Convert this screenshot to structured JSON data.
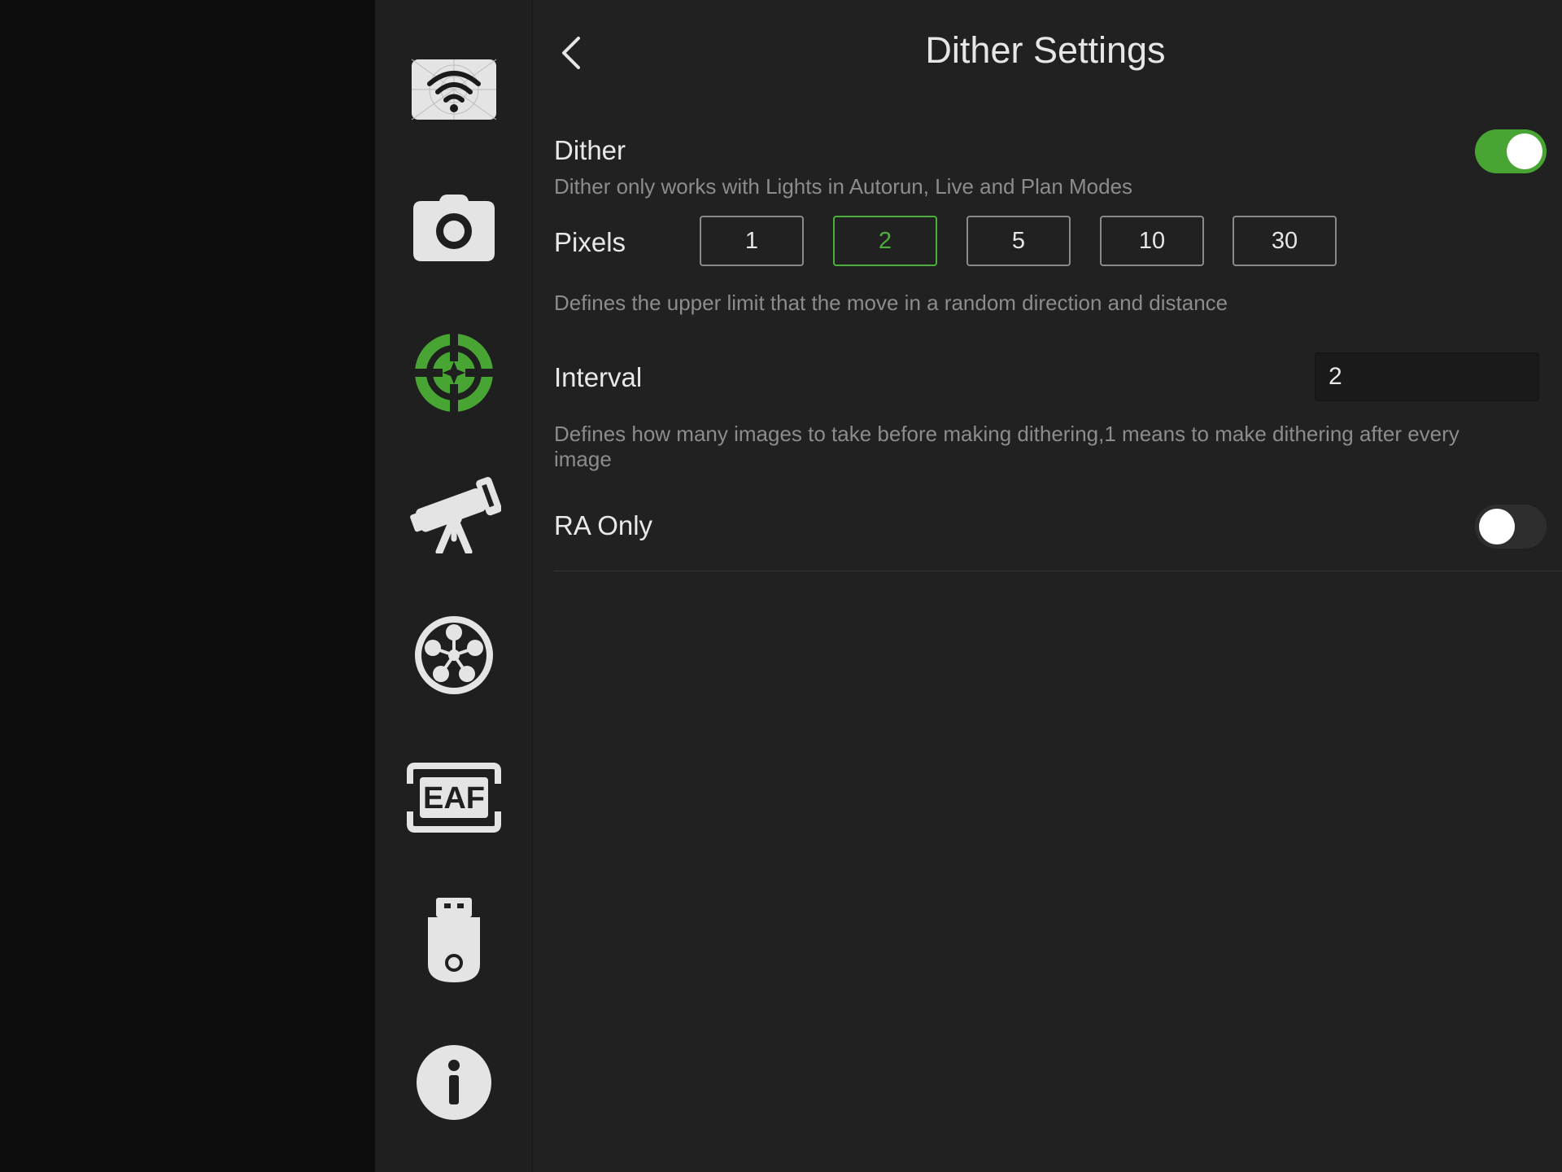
{
  "header": {
    "title": "Dither Settings"
  },
  "sidebar": {
    "items": [
      {
        "icon": "wifi-icon"
      },
      {
        "icon": "camera-icon"
      },
      {
        "icon": "guide-target-icon",
        "active": true
      },
      {
        "icon": "telescope-icon"
      },
      {
        "icon": "filter-wheel-icon"
      },
      {
        "icon": "eaf-icon",
        "label": "EAF"
      },
      {
        "icon": "usb-drive-icon"
      },
      {
        "icon": "info-icon"
      }
    ],
    "accent_color": "#48a534"
  },
  "dither": {
    "label": "Dither",
    "enabled": true,
    "description": "Dither only works with Lights in Autorun, Live and Plan Modes"
  },
  "pixels": {
    "label": "Pixels",
    "options": [
      "1",
      "2",
      "5",
      "10",
      "30"
    ],
    "selected": "2",
    "description": "Defines the upper limit that the move in a random direction and distance"
  },
  "interval": {
    "label": "Interval",
    "value": "2",
    "description": "Defines how many images to take before making dithering,1 means to make dithering after every image"
  },
  "ra_only": {
    "label": "RA Only",
    "enabled": false
  }
}
